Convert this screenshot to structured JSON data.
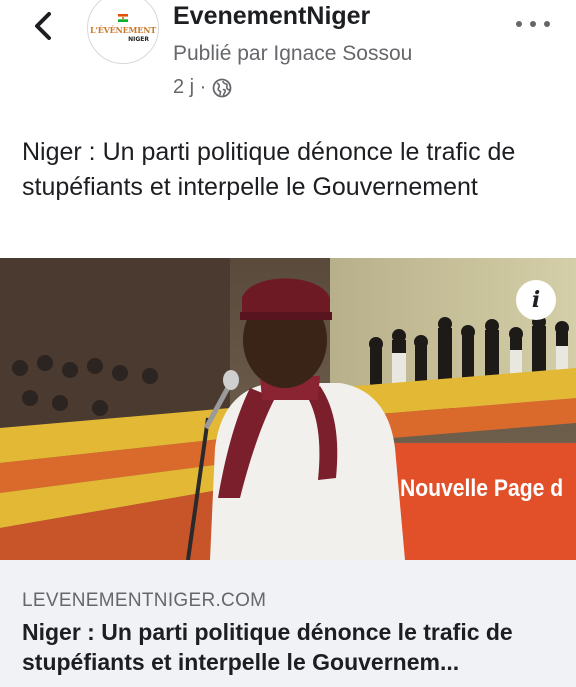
{
  "header": {
    "back_icon": "chevron-left-icon",
    "avatar": {
      "logo_line1": "L'ÉVÉNEMENT",
      "logo_line2": "NIGER"
    },
    "page_name": "EvenementNiger",
    "published_by": "Publié par Ignace Sossou",
    "time": "2 j ·",
    "privacy_icon": "globe-icon",
    "more_icon": "more-horizontal-icon"
  },
  "post": {
    "text": "Niger : Un parti politique dénonce le trafic de stupéfiants et interpelle le Gouvernement"
  },
  "photo": {
    "info_icon": "info-icon",
    "info_label": "i",
    "banner_text": "Nouvelle Page d"
  },
  "link_preview": {
    "domain": "LEVENEMENTNIGER.COM",
    "title": "Niger : Un parti politique dénonce le trafic de stupéfiants et interpelle le Gouvernem..."
  },
  "colors": {
    "text_primary": "#1c1e21",
    "text_secondary": "#65676b",
    "card_background": "#f0f2f5",
    "banner_orange": "#e2502a"
  }
}
